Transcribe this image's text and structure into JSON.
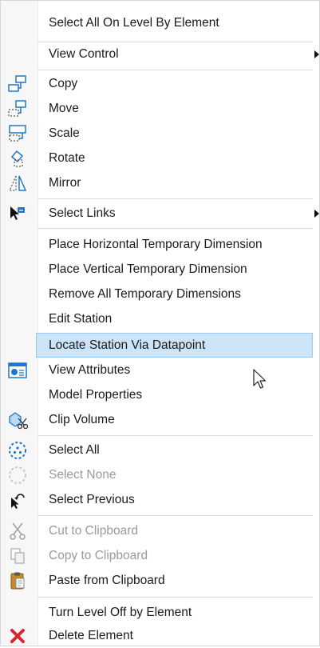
{
  "menu": {
    "items": [
      {
        "label": "Select All On Level By Element"
      },
      {
        "label": "View Control"
      },
      {
        "label": "Copy"
      },
      {
        "label": "Move"
      },
      {
        "label": "Scale"
      },
      {
        "label": "Rotate"
      },
      {
        "label": "Mirror"
      },
      {
        "label": "Select Links"
      },
      {
        "label": "Place Horizontal Temporary Dimension"
      },
      {
        "label": "Place Vertical Temporary Dimension"
      },
      {
        "label": "Remove All Temporary Dimensions"
      },
      {
        "label": "Edit Station"
      },
      {
        "label": "Locate Station Via Datapoint"
      },
      {
        "label": "View Attributes"
      },
      {
        "label": "Model Properties"
      },
      {
        "label": "Clip Volume"
      },
      {
        "label": "Select All"
      },
      {
        "label": "Select None"
      },
      {
        "label": "Select Previous"
      },
      {
        "label": "Cut to Clipboard"
      },
      {
        "label": "Copy to Clipboard"
      },
      {
        "label": "Paste from Clipboard"
      },
      {
        "label": "Turn Level Off by Element"
      },
      {
        "label": "Delete Element"
      }
    ]
  },
  "icons": {
    "copy": "copy-icon",
    "move": "move-icon",
    "scale": "scale-icon",
    "rotate": "rotate-icon",
    "mirror": "mirror-icon",
    "select_links": "select-links-icon",
    "view_attributes": "view-attributes-icon",
    "clip_volume": "clip-volume-icon",
    "select_all": "select-all-icon",
    "select_none": "select-none-icon",
    "select_previous": "select-previous-icon",
    "cut": "scissors-icon",
    "copy_clipboard": "copy-document-icon",
    "paste": "clipboard-icon",
    "delete": "red-x-icon"
  },
  "colors": {
    "highlight_bg": "#cce4f7",
    "highlight_border": "#99c9ef",
    "disabled_text": "#9a9a9a",
    "icon_blue": "#1e78c8",
    "delete_red": "#d9262e"
  }
}
